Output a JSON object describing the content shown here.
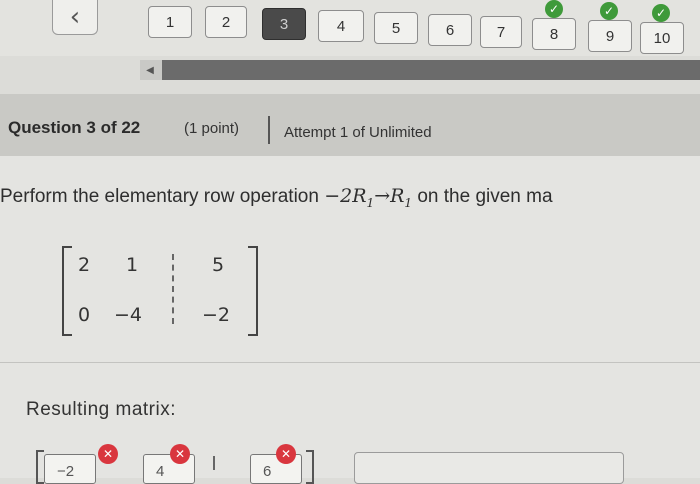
{
  "nav": {
    "back_glyph": "‹",
    "questions": [
      {
        "label": "1",
        "state": "default"
      },
      {
        "label": "2",
        "state": "default"
      },
      {
        "label": "3",
        "state": "current"
      },
      {
        "label": "4",
        "state": "default"
      },
      {
        "label": "5",
        "state": "default"
      },
      {
        "label": "6",
        "state": "default"
      },
      {
        "label": "7",
        "state": "default"
      },
      {
        "label": "8",
        "state": "answered"
      },
      {
        "label": "9",
        "state": "answered"
      },
      {
        "label": "10",
        "state": "answered"
      }
    ],
    "check_glyph": "✓",
    "scroll_left_glyph": "◀"
  },
  "header": {
    "title": "Question 3 of 22",
    "points": "(1 point)",
    "attempt": "Attempt 1 of Unlimited"
  },
  "question": {
    "prompt_before": "Perform the elementary row operation ",
    "operation": "−2R",
    "sub1": "1",
    "arrow": "→R",
    "sub2": "1",
    "prompt_after": " on the given ma"
  },
  "matrix": {
    "rows": [
      [
        "2",
        "1",
        "5"
      ],
      [
        "0",
        "−4",
        "−2"
      ]
    ]
  },
  "answer": {
    "label": "Resulting matrix:",
    "cells": [
      "−2",
      "4",
      "6"
    ],
    "error_glyph": "✕"
  },
  "colors": {
    "answered_check": "#3f9a3a",
    "error": "#d9363e",
    "current_question": "#4a4a4a"
  }
}
